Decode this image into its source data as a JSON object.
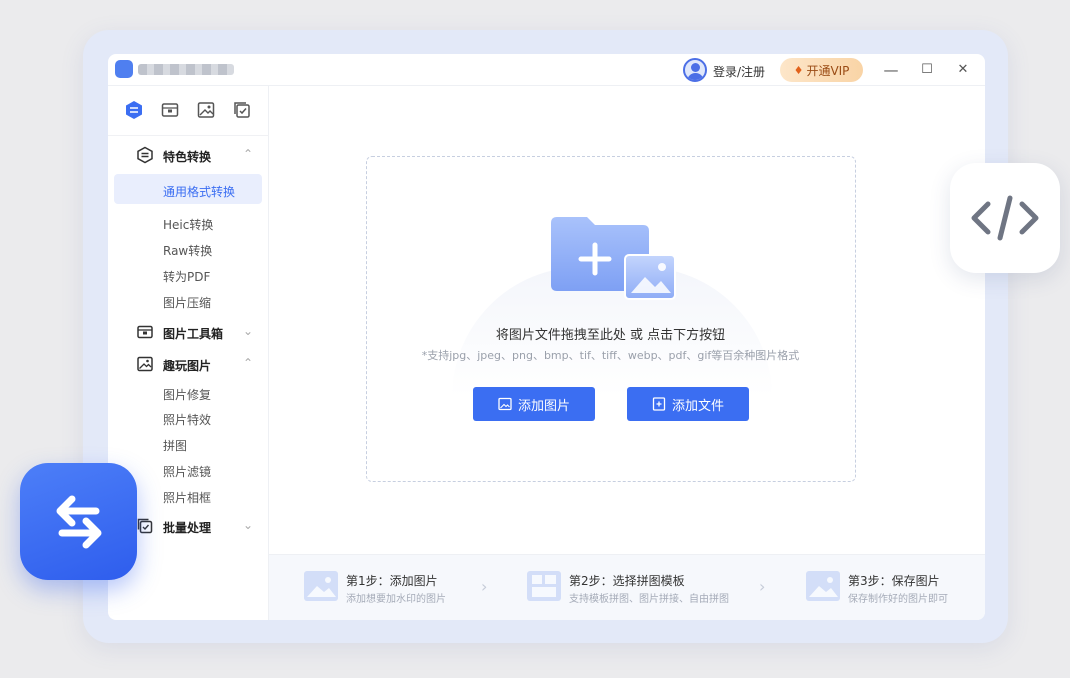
{
  "titlebar": {
    "login_label": "登录/注册",
    "vip_label": "开通VIP",
    "minimize_glyph": "—",
    "maximize_glyph": "☐",
    "close_glyph": "✕"
  },
  "sidebar": {
    "icon_tabs": [
      "convert-icon",
      "toolbox-icon",
      "image-icon",
      "batch-icon"
    ],
    "groups": [
      {
        "label": "特色转换",
        "icon": "convert-icon",
        "expanded": true,
        "items": [
          "通用格式转换",
          "Heic转换",
          "Raw转换",
          "转为PDF",
          "图片压缩"
        ]
      },
      {
        "label": "图片工具箱",
        "icon": "toolbox-icon",
        "expanded": false,
        "items": []
      },
      {
        "label": "趣玩图片",
        "icon": "image-icon",
        "expanded": true,
        "items": [
          "图片修复",
          "照片特效",
          "拼图",
          "照片滤镜",
          "照片相框"
        ]
      },
      {
        "label": "批量处理",
        "icon": "batch-icon",
        "expanded": false,
        "items": []
      }
    ],
    "active_item": "通用格式转换"
  },
  "dropzone": {
    "hint": "将图片文件拖拽至此处 或 点击下方按钮",
    "formats": "*支持jpg、jpeg、png、bmp、tif、tiff、webp、pdf、gif等百余种图片格式",
    "add_image_label": "添加图片",
    "add_file_label": "添加文件"
  },
  "steps": [
    {
      "title": "第1步：添加图片",
      "desc": "添加想要加水印的图片"
    },
    {
      "title": "第2步：选择拼图模板",
      "desc": "支持模板拼图、图片拼接、自由拼图"
    },
    {
      "title": "第3步：保存图片",
      "desc": "保存制作好的图片即可"
    }
  ],
  "colors": {
    "accent": "#3b6ef2",
    "active_bg": "#e9eefd",
    "vip_text": "#9a4b14"
  }
}
